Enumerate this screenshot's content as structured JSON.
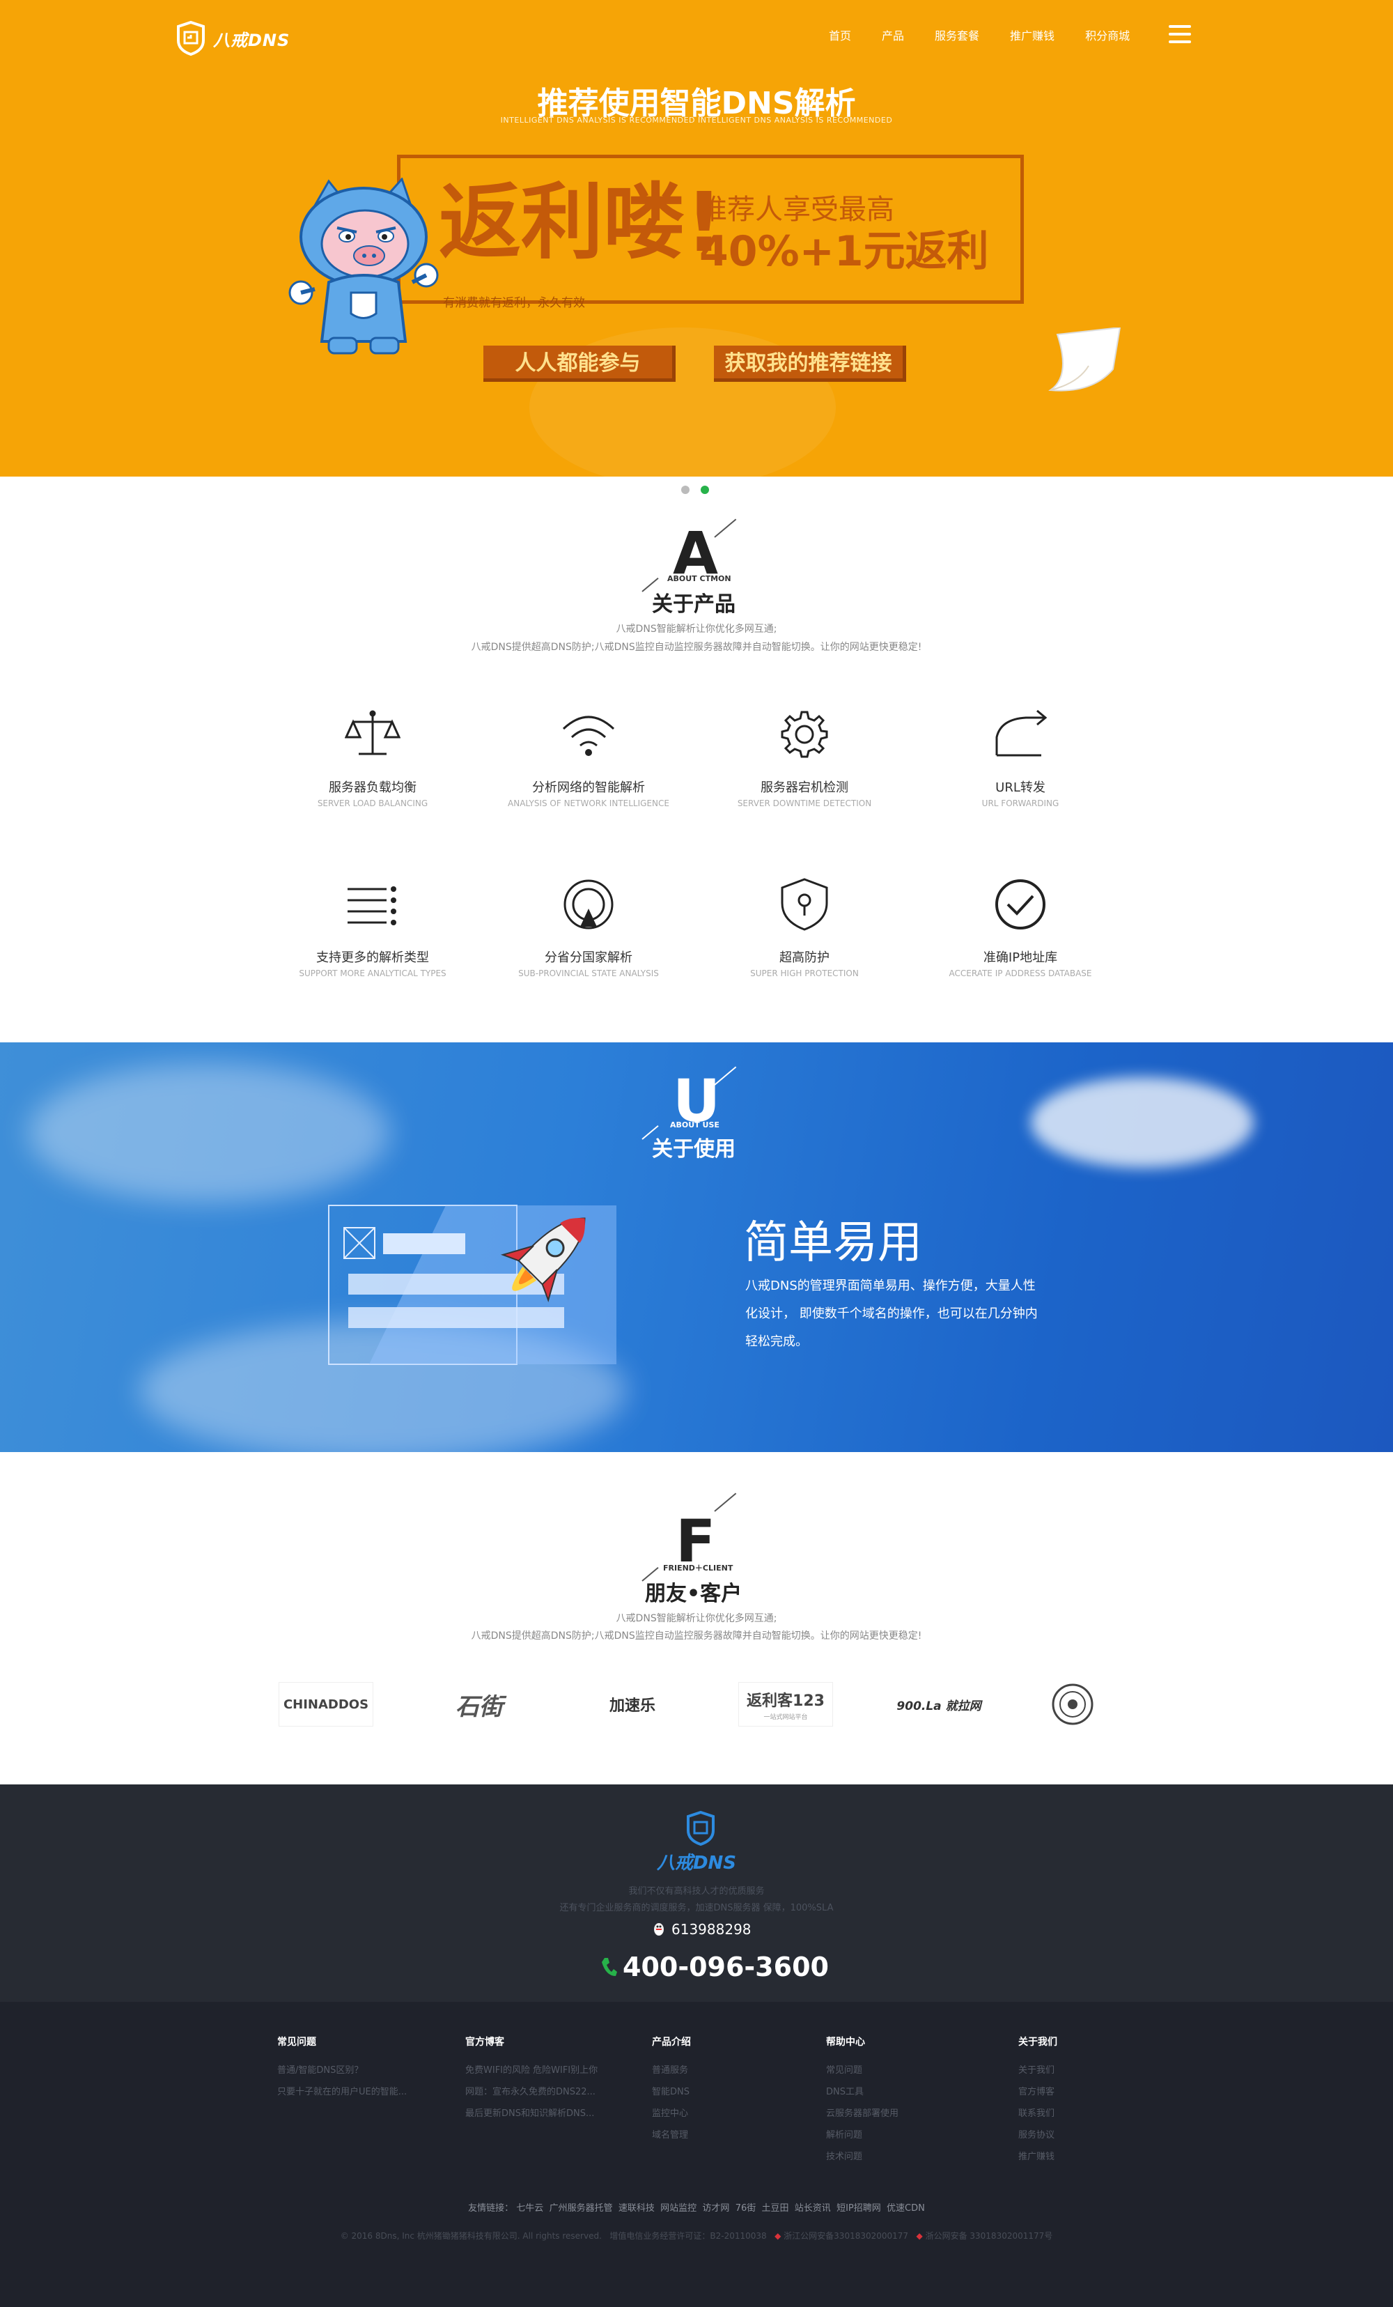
{
  "nav": {
    "logo_text": "八戒DNS",
    "items": [
      "首页",
      "产品",
      "服务套餐",
      "推广赚钱",
      "积分商城"
    ]
  },
  "hero": {
    "title": "推荐使用智能DNS解析",
    "subtitle": "INTELLIGENT DNS ANALYSIS IS RECOMMENDED  INTELLIGENT DNS ANALYSIS IS RECOMMENDED",
    "promo_big": "返利喽!",
    "promo_line1": "推荐人享受最高",
    "promo_line2": "40%+1元返利",
    "note": "有消费就有返利，永久有效",
    "btn_participate": "人人都能参与",
    "btn_get_link": "获取我的推荐链接",
    "slide_count": 2,
    "active_slide": 1
  },
  "about_product": {
    "letter": "A",
    "caption": "ABOUT CTMON",
    "title": "关于产品",
    "desc1": "八戒DNS智能解析让你优化多网互通;",
    "desc2": "八戒DNS提供超高DNS防护;八戒DNS监控自动监控服务器故障并自动智能切换。让你的网站更快更稳定!",
    "features": [
      {
        "icon": "balance-scale-icon",
        "zh": "服务器负载均衡",
        "en": "SERVER LOAD BALANCING"
      },
      {
        "icon": "wifi-icon",
        "zh": "分析网络的智能解析",
        "en": "ANALYSIS OF NETWORK INTELLIGENCE"
      },
      {
        "icon": "gear-icon",
        "zh": "服务器宕机检测",
        "en": "SERVER DOWNTIME DETECTION"
      },
      {
        "icon": "forward-arrow-icon",
        "zh": "URL转发",
        "en": "URL FORWARDING"
      },
      {
        "icon": "list-icon",
        "zh": "支持更多的解析类型",
        "en": "SUPPORT MORE ANALYTICAL TYPES"
      },
      {
        "icon": "location-circle-icon",
        "zh": "分省分国家解析",
        "en": "SUB-PROVINCIAL STATE ANALYSIS"
      },
      {
        "icon": "shield-icon",
        "zh": "超高防护",
        "en": "SUPER HIGH PROTECTION"
      },
      {
        "icon": "check-circle-icon",
        "zh": "准确IP地址库",
        "en": "ACCERATE IP ADDRESS DATABASE"
      }
    ]
  },
  "about_use": {
    "letter": "U",
    "caption": "ABOUT USE",
    "title": "关于使用",
    "headline": "简单易用",
    "text": "八戒DNS的管理界面简单易用、操作方便，大量人性化设计， 即使数千个域名的操作，也可以在几分钟内轻松完成。"
  },
  "friends": {
    "letter": "F",
    "caption": "FRIEND＋CLIENT",
    "title": "朋友•客户",
    "desc1": "八戒DNS智能解析让你优化多网互通;",
    "desc2": "八戒DNS提供超高DNS防护;八戒DNS监控自动监控服务器故障并自动智能切换。让你的网站更快更稳定!",
    "logos": [
      "CHINADDOS",
      "石街",
      "加速乐",
      "返利客123",
      "900.La 就拉网",
      "seal-logo"
    ],
    "logo_sub": "一站式网站平台"
  },
  "footer": {
    "logo_text": "八戒DNS",
    "tagline1": "我们不仅有高科技人才的优质服务",
    "tagline2": "还有专门企业服务商的调度服务，加速DNS服务器 保障，100%SLA",
    "qq": "613988298",
    "phone": "400-096-3600",
    "columns": [
      {
        "title": "常见问题",
        "links": [
          "普通/智能DNS区别？",
          "只要十子就在的用户UE的智能..."
        ]
      },
      {
        "title": "官方博客",
        "links": [
          "免费WIFI的风险 危险WIFI别上你",
          "网题：宣布永久免费的DNS22...",
          "最后更新DNS和知识解析DNS..."
        ]
      },
      {
        "title": "产品介绍",
        "links": [
          "普通服务",
          "智能DNS",
          "监控中心",
          "域名管理"
        ]
      },
      {
        "title": "帮助中心",
        "links": [
          "常见问题",
          "DNS工具",
          "云服务器部署使用",
          "解析问题",
          "技术问题"
        ]
      },
      {
        "title": "关于我们",
        "links": [
          "关于我们",
          "官方博客",
          "联系我们",
          "服务协议",
          "推广赚钱"
        ]
      }
    ],
    "friend_links_label": "友情链接：",
    "friend_links": [
      "七牛云",
      "广州服务器托管",
      "速联科技",
      "网站监控",
      "访才网",
      "76街",
      "土豆田",
      "站长资讯",
      "短IP招聘网",
      "优速CDN"
    ],
    "copyright": "© 2016 8Dns, Inc 杭州猪锄猪猪科技有限公司. All rights reserved.",
    "icp": "增值电信业务经营许可证：B2-20110038",
    "police1": "浙江公网安备33018302000177",
    "police2": "浙公网安备 33018302001177号"
  },
  "colors": {
    "hero_orange": "#f6a406",
    "promo_brown": "#c45a0a",
    "use_blue": "#2c7fd8",
    "footer_dark": "#1f222b",
    "accent_green": "#27b24a"
  }
}
